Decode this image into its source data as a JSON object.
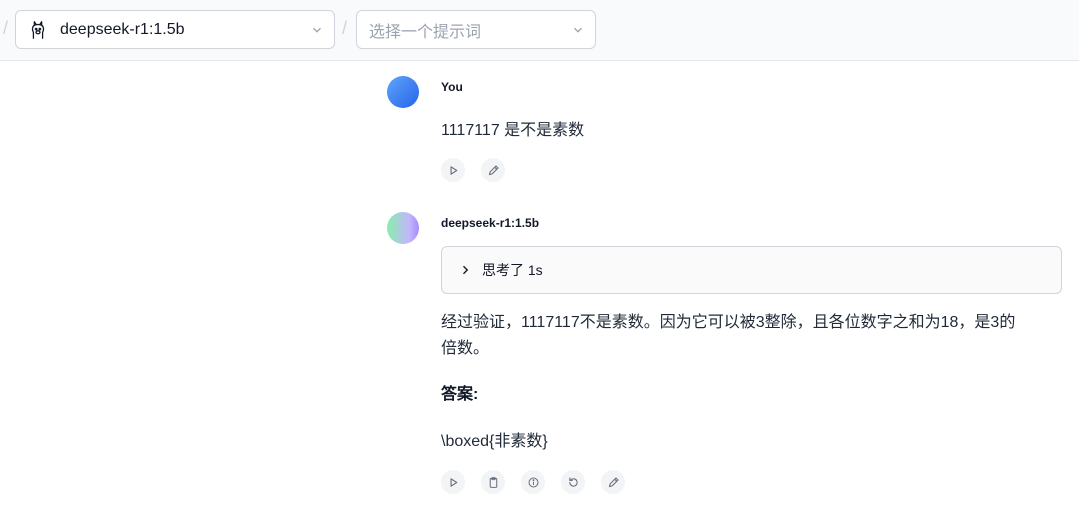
{
  "header": {
    "separator": "/",
    "model_select": {
      "value": "deepseek-r1:1.5b"
    },
    "prompt_select": {
      "placeholder": "选择一个提示词"
    }
  },
  "chat": {
    "user_message": {
      "sender": "You",
      "text": "1117117 是不是素数"
    },
    "assistant_message": {
      "sender": "deepseek-r1:1.5b",
      "thinking_label": "思考了 1s",
      "paragraph": "经过验证，1117117不是素数。因为它可以被3整除，且各位数字之和为18，是3的倍数。",
      "answer_label": "答案:",
      "boxed": "\\boxed{非素数}"
    }
  },
  "icons": {
    "model_logo": "llama-icon",
    "dropdown": "chevron-down-icon",
    "play": "play-icon",
    "edit": "pencil-icon",
    "copy": "clipboard-icon",
    "info": "info-icon",
    "regenerate": "refresh-icon",
    "expand": "chevron-right-icon"
  }
}
